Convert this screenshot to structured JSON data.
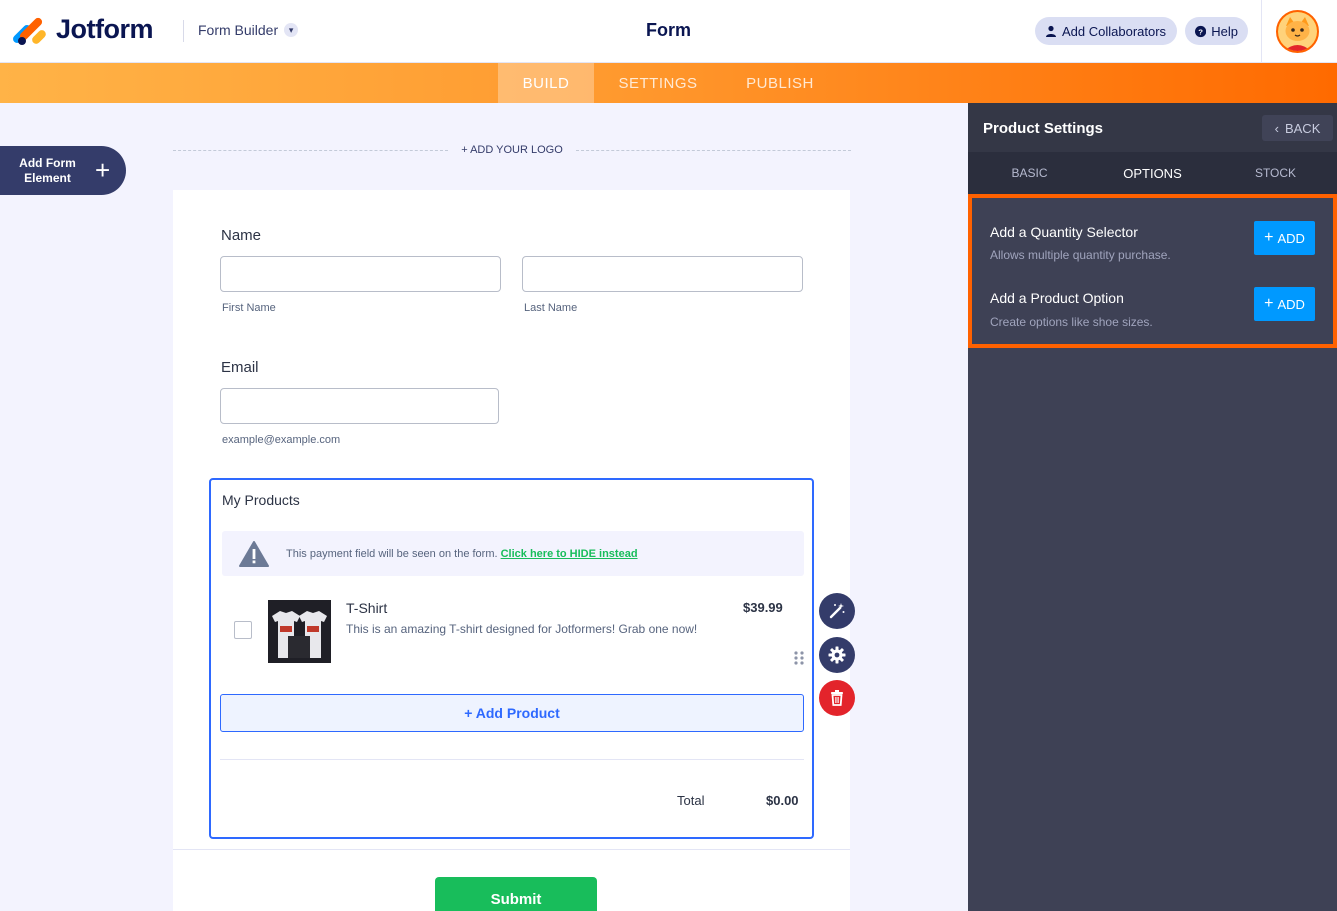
{
  "header": {
    "brand": "Jotform",
    "builder_label": "Form Builder",
    "page_title": "Form",
    "collaborators_label": "Add Collaborators",
    "help_label": "Help"
  },
  "tabs": [
    {
      "label": "BUILD",
      "active": true
    },
    {
      "label": "SETTINGS",
      "active": false
    },
    {
      "label": "PUBLISH",
      "active": false
    }
  ],
  "canvas": {
    "add_element_label": "Add Form Element",
    "add_logo_label": "+ ADD YOUR LOGO"
  },
  "form": {
    "name_label": "Name",
    "first_name_sublabel": "First Name",
    "last_name_sublabel": "Last Name",
    "email_label": "Email",
    "email_sublabel": "example@example.com",
    "products_label": "My Products",
    "notice_text": "This payment field will be seen on the form.",
    "notice_link": "Click here to HIDE instead",
    "product": {
      "name": "T-Shirt",
      "price": "$39.99",
      "description": "This is an amazing T-shirt designed for Jotformers! Grab one now!"
    },
    "add_product_label": "+ Add Product",
    "total_label": "Total",
    "total_value": "$0.00",
    "submit_label": "Submit"
  },
  "panel": {
    "title": "Product Settings",
    "back_label": "BACK",
    "tabs": [
      {
        "label": "BASIC",
        "active": false
      },
      {
        "label": "OPTIONS",
        "active": true
      },
      {
        "label": "STOCK",
        "active": false
      }
    ],
    "options": [
      {
        "title": "Add a Quantity Selector",
        "desc": "Allows multiple quantity purchase.",
        "button": "ADD"
      },
      {
        "title": "Add a Product Option",
        "desc": "Create options like shoe sizes.",
        "button": "ADD"
      }
    ]
  },
  "colors": {
    "accent_orange": "#ff6100",
    "accent_blue": "#0099ff",
    "submit_green": "#18bd5b",
    "delete_red": "#e3242b",
    "panel_bg": "#3e4155"
  }
}
